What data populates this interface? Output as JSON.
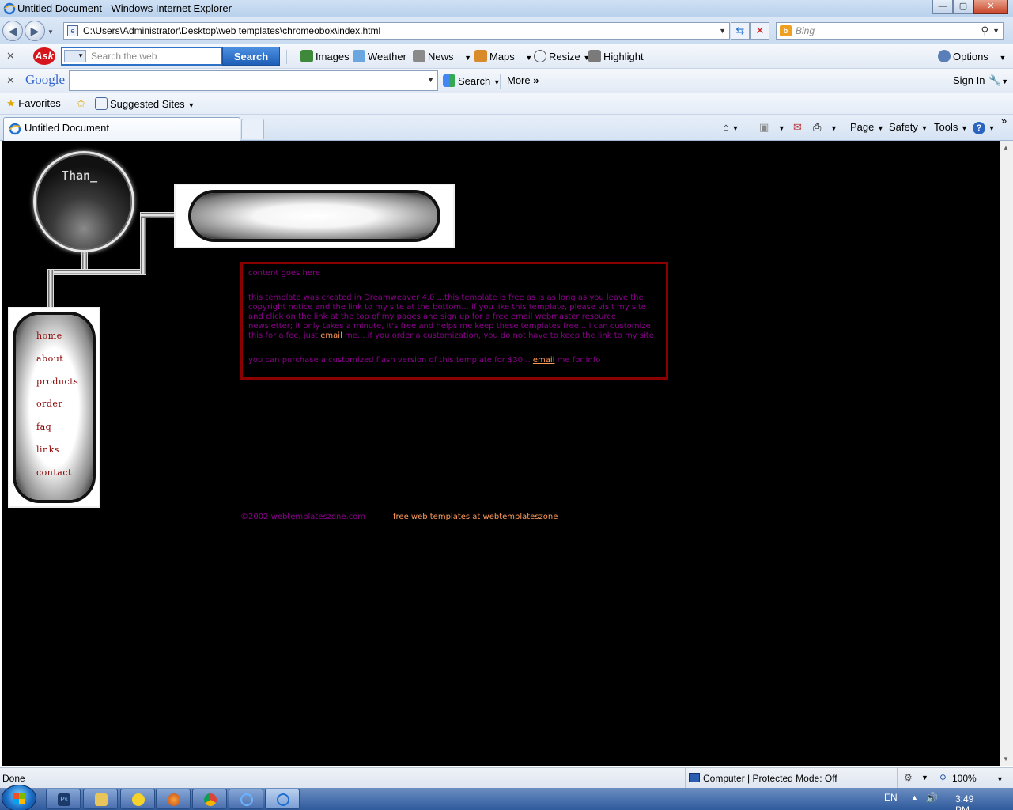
{
  "window": {
    "title": "Untitled Document - Windows Internet Explorer",
    "min_label": "—",
    "max_label": "▢",
    "close_label": "✕"
  },
  "address": {
    "url": "C:\\Users\\Administrator\\Desktop\\web templates\\chromeobox\\index.html",
    "search_placeholder": "Bing"
  },
  "ask_toolbar": {
    "logo": "Ask",
    "search_placeholder": "Search the web",
    "search_button": "Search",
    "items": [
      "Images",
      "Weather",
      "News",
      "Maps",
      "Resize",
      "Highlight"
    ],
    "options": "Options"
  },
  "google_toolbar": {
    "logo": "Google",
    "search": "Search",
    "more": "More",
    "more_glyph": "»",
    "signin": "Sign In"
  },
  "favorites_bar": {
    "favorites": "Favorites",
    "suggested": "Suggested Sites"
  },
  "tabs": {
    "active_title": "Untitled Document"
  },
  "command_bar": {
    "page": "Page",
    "safety": "Safety",
    "tools": "Tools",
    "help": "?"
  },
  "page": {
    "orb_label": "Than_",
    "nav": [
      "home",
      "about",
      "products",
      "order",
      "faq",
      "links",
      "contact"
    ],
    "content": {
      "heading": "content goes here",
      "para1_pre": "this template was created in Dreamweaver 4.0 ...this template is free as is as long as you leave the copyright notice and the link to my site at the bottom... if you like this template, please visit my site and click on the link at the top of my pages and sign up for a free email webmaster resource newsletter; it only takes a minute, it's free and helps me keep these templates free... i can customize this for a fee, just",
      "para1_link": "email",
      "para1_post": "me... if you order a customization, you do not have to keep the link to my site",
      "para2_pre": "you can purchase a customized flash version of this template for $30...",
      "para2_link": "email",
      "para2_post": "me for info"
    },
    "footer_copy": "©2002 webtemplateszone.com",
    "footer_link": "free web templates at webtemplateszone"
  },
  "status": {
    "text": "Done",
    "zone": "Computer | Protected Mode: Off",
    "zoom": "100%"
  },
  "taskbar": {
    "lang": "EN",
    "time": "3:49 PM",
    "apps": [
      "Photoshop",
      "Windows Explorer",
      "Messenger",
      "Firefox",
      "Chrome",
      "Internet Explorer 1",
      "Internet Explorer 2"
    ]
  },
  "colors": {
    "content_text": "#8b008b",
    "content_border": "#8b0000",
    "link": "#ff9a5a",
    "nav_text": "#8b0000",
    "page_bg": "#000000"
  }
}
